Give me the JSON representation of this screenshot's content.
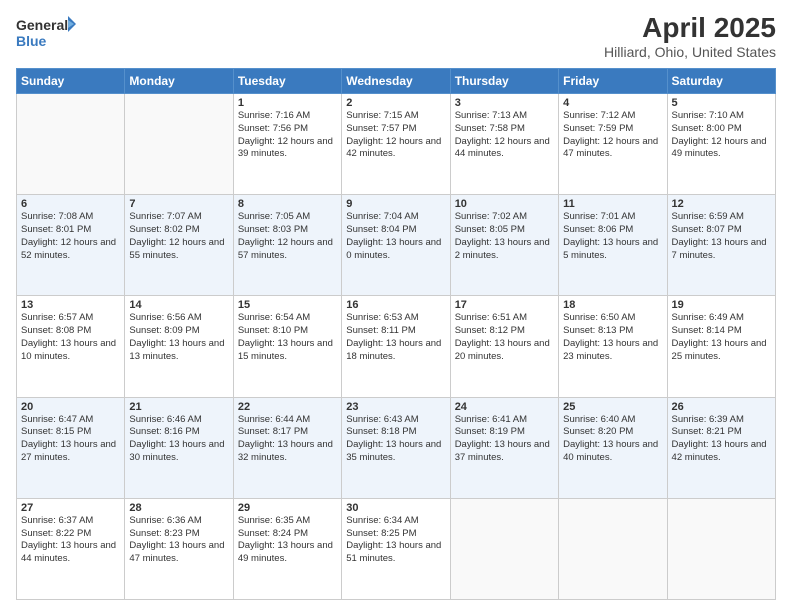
{
  "header": {
    "logo_general": "General",
    "logo_blue": "Blue",
    "month": "April 2025",
    "location": "Hilliard, Ohio, United States"
  },
  "days_of_week": [
    "Sunday",
    "Monday",
    "Tuesday",
    "Wednesday",
    "Thursday",
    "Friday",
    "Saturday"
  ],
  "weeks": [
    [
      {
        "day": "",
        "info": ""
      },
      {
        "day": "",
        "info": ""
      },
      {
        "day": "1",
        "sunrise": "7:16 AM",
        "sunset": "7:56 PM",
        "daylight": "12 hours and 39 minutes."
      },
      {
        "day": "2",
        "sunrise": "7:15 AM",
        "sunset": "7:57 PM",
        "daylight": "12 hours and 42 minutes."
      },
      {
        "day": "3",
        "sunrise": "7:13 AM",
        "sunset": "7:58 PM",
        "daylight": "12 hours and 44 minutes."
      },
      {
        "day": "4",
        "sunrise": "7:12 AM",
        "sunset": "7:59 PM",
        "daylight": "12 hours and 47 minutes."
      },
      {
        "day": "5",
        "sunrise": "7:10 AM",
        "sunset": "8:00 PM",
        "daylight": "12 hours and 49 minutes."
      }
    ],
    [
      {
        "day": "6",
        "sunrise": "7:08 AM",
        "sunset": "8:01 PM",
        "daylight": "12 hours and 52 minutes."
      },
      {
        "day": "7",
        "sunrise": "7:07 AM",
        "sunset": "8:02 PM",
        "daylight": "12 hours and 55 minutes."
      },
      {
        "day": "8",
        "sunrise": "7:05 AM",
        "sunset": "8:03 PM",
        "daylight": "12 hours and 57 minutes."
      },
      {
        "day": "9",
        "sunrise": "7:04 AM",
        "sunset": "8:04 PM",
        "daylight": "13 hours and 0 minutes."
      },
      {
        "day": "10",
        "sunrise": "7:02 AM",
        "sunset": "8:05 PM",
        "daylight": "13 hours and 2 minutes."
      },
      {
        "day": "11",
        "sunrise": "7:01 AM",
        "sunset": "8:06 PM",
        "daylight": "13 hours and 5 minutes."
      },
      {
        "day": "12",
        "sunrise": "6:59 AM",
        "sunset": "8:07 PM",
        "daylight": "13 hours and 7 minutes."
      }
    ],
    [
      {
        "day": "13",
        "sunrise": "6:57 AM",
        "sunset": "8:08 PM",
        "daylight": "13 hours and 10 minutes."
      },
      {
        "day": "14",
        "sunrise": "6:56 AM",
        "sunset": "8:09 PM",
        "daylight": "13 hours and 13 minutes."
      },
      {
        "day": "15",
        "sunrise": "6:54 AM",
        "sunset": "8:10 PM",
        "daylight": "13 hours and 15 minutes."
      },
      {
        "day": "16",
        "sunrise": "6:53 AM",
        "sunset": "8:11 PM",
        "daylight": "13 hours and 18 minutes."
      },
      {
        "day": "17",
        "sunrise": "6:51 AM",
        "sunset": "8:12 PM",
        "daylight": "13 hours and 20 minutes."
      },
      {
        "day": "18",
        "sunrise": "6:50 AM",
        "sunset": "8:13 PM",
        "daylight": "13 hours and 23 minutes."
      },
      {
        "day": "19",
        "sunrise": "6:49 AM",
        "sunset": "8:14 PM",
        "daylight": "13 hours and 25 minutes."
      }
    ],
    [
      {
        "day": "20",
        "sunrise": "6:47 AM",
        "sunset": "8:15 PM",
        "daylight": "13 hours and 27 minutes."
      },
      {
        "day": "21",
        "sunrise": "6:46 AM",
        "sunset": "8:16 PM",
        "daylight": "13 hours and 30 minutes."
      },
      {
        "day": "22",
        "sunrise": "6:44 AM",
        "sunset": "8:17 PM",
        "daylight": "13 hours and 32 minutes."
      },
      {
        "day": "23",
        "sunrise": "6:43 AM",
        "sunset": "8:18 PM",
        "daylight": "13 hours and 35 minutes."
      },
      {
        "day": "24",
        "sunrise": "6:41 AM",
        "sunset": "8:19 PM",
        "daylight": "13 hours and 37 minutes."
      },
      {
        "day": "25",
        "sunrise": "6:40 AM",
        "sunset": "8:20 PM",
        "daylight": "13 hours and 40 minutes."
      },
      {
        "day": "26",
        "sunrise": "6:39 AM",
        "sunset": "8:21 PM",
        "daylight": "13 hours and 42 minutes."
      }
    ],
    [
      {
        "day": "27",
        "sunrise": "6:37 AM",
        "sunset": "8:22 PM",
        "daylight": "13 hours and 44 minutes."
      },
      {
        "day": "28",
        "sunrise": "6:36 AM",
        "sunset": "8:23 PM",
        "daylight": "13 hours and 47 minutes."
      },
      {
        "day": "29",
        "sunrise": "6:35 AM",
        "sunset": "8:24 PM",
        "daylight": "13 hours and 49 minutes."
      },
      {
        "day": "30",
        "sunrise": "6:34 AM",
        "sunset": "8:25 PM",
        "daylight": "13 hours and 51 minutes."
      },
      {
        "day": "",
        "info": ""
      },
      {
        "day": "",
        "info": ""
      },
      {
        "day": "",
        "info": ""
      }
    ]
  ]
}
